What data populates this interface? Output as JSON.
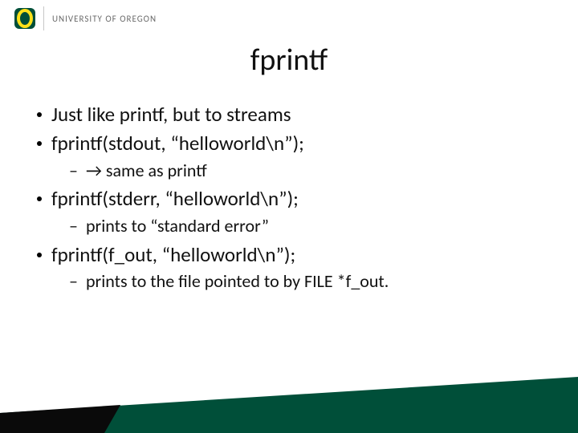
{
  "header": {
    "org_text": "UNIVERSITY OF OREGON"
  },
  "title": "fprintf",
  "bullets": [
    {
      "level": 1,
      "text": "Just like printf, but to streams"
    },
    {
      "level": 1,
      "text": "fprintf(stdout, “helloworld\\n”);"
    },
    {
      "level": 2,
      "text": "→ same as printf"
    },
    {
      "level": 1,
      "text": "fprintf(stderr, “helloworld\\n”);"
    },
    {
      "level": 2,
      "text": "prints to “standard error”"
    },
    {
      "level": 1,
      "text": "fprintf(f_out, “helloworld\\n”);"
    },
    {
      "level": 2,
      "text": "prints to the file pointed to by FILE *f_out."
    }
  ],
  "colors": {
    "brand_green": "#004F39",
    "brand_yellow": "#FEE11A"
  }
}
